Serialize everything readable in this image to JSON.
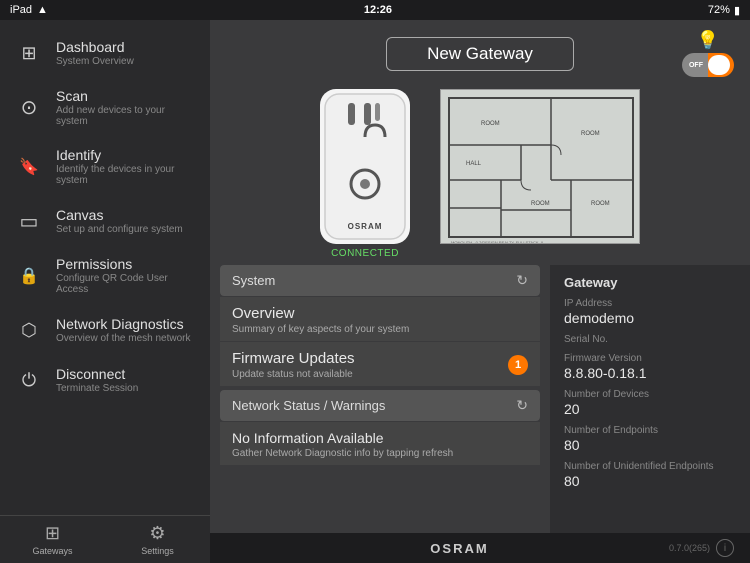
{
  "statusBar": {
    "device": "iPad",
    "wifi": "wifi",
    "time": "12:26",
    "battery": "72%"
  },
  "header": {
    "gatewayTitle": "New Gateway",
    "toggleOff": "OFF",
    "toggleOn": "ON"
  },
  "device": {
    "brand": "OSRAM",
    "status": "CONNECTED"
  },
  "sidebar": {
    "items": [
      {
        "id": "dashboard",
        "label": "Dashboard",
        "sublabel": "System Overview",
        "icon": "⊞"
      },
      {
        "id": "scan",
        "label": "Scan",
        "sublabel": "Add new devices to your system",
        "icon": "⊙"
      },
      {
        "id": "identify",
        "label": "Identify",
        "sublabel": "Identify the devices in your system",
        "icon": "🔖"
      },
      {
        "id": "canvas",
        "label": "Canvas",
        "sublabel": "Set up and configure system",
        "icon": "▭"
      },
      {
        "id": "permissions",
        "label": "Permissions",
        "sublabel": "Configure QR Code User Access",
        "icon": "🔒"
      },
      {
        "id": "network-diagnostics",
        "label": "Network Diagnostics",
        "sublabel": "Overview of the mesh network",
        "icon": "⬡"
      },
      {
        "id": "disconnect",
        "label": "Disconnect",
        "sublabel": "Terminate Session",
        "icon": "⏻"
      }
    ],
    "footer": [
      {
        "id": "gateways",
        "label": "Gateways",
        "icon": "⊞",
        "active": false
      },
      {
        "id": "settings",
        "label": "Settings",
        "icon": "⚙",
        "active": false
      }
    ]
  },
  "system": {
    "sectionLabel": "System",
    "items": [
      {
        "id": "overview",
        "title": "Overview",
        "subtitle": "Summary of key aspects of your system",
        "badge": null
      },
      {
        "id": "firmware",
        "title": "Firmware Updates",
        "subtitle": "Update status not available",
        "badge": "1"
      }
    ],
    "networkSection": "Network Status / Warnings",
    "noInfoTitle": "No Information Available",
    "noInfoSub": "Gather Network Diagnostic info by tapping refresh"
  },
  "gateway": {
    "sectionLabel": "Gateway",
    "ipAddressLabel": "IP Address",
    "ipAddressValue": "demodemo",
    "serialNoLabel": "Serial No.",
    "serialNoValue": "",
    "firmwareLabel": "Firmware Version",
    "firmwareValue": "8.8.80-0.18.1",
    "numDevicesLabel": "Number of Devices",
    "numDevicesValue": "20",
    "numEndpointsLabel": "Number of Endpoints",
    "numEndpointsValue": "80",
    "numUnidentLabel": "Number of Unidentified Endpoints",
    "numUnidentValue": "80"
  },
  "bottomBar": {
    "brand": "OSRAM",
    "version": "0.7.0(265)"
  }
}
